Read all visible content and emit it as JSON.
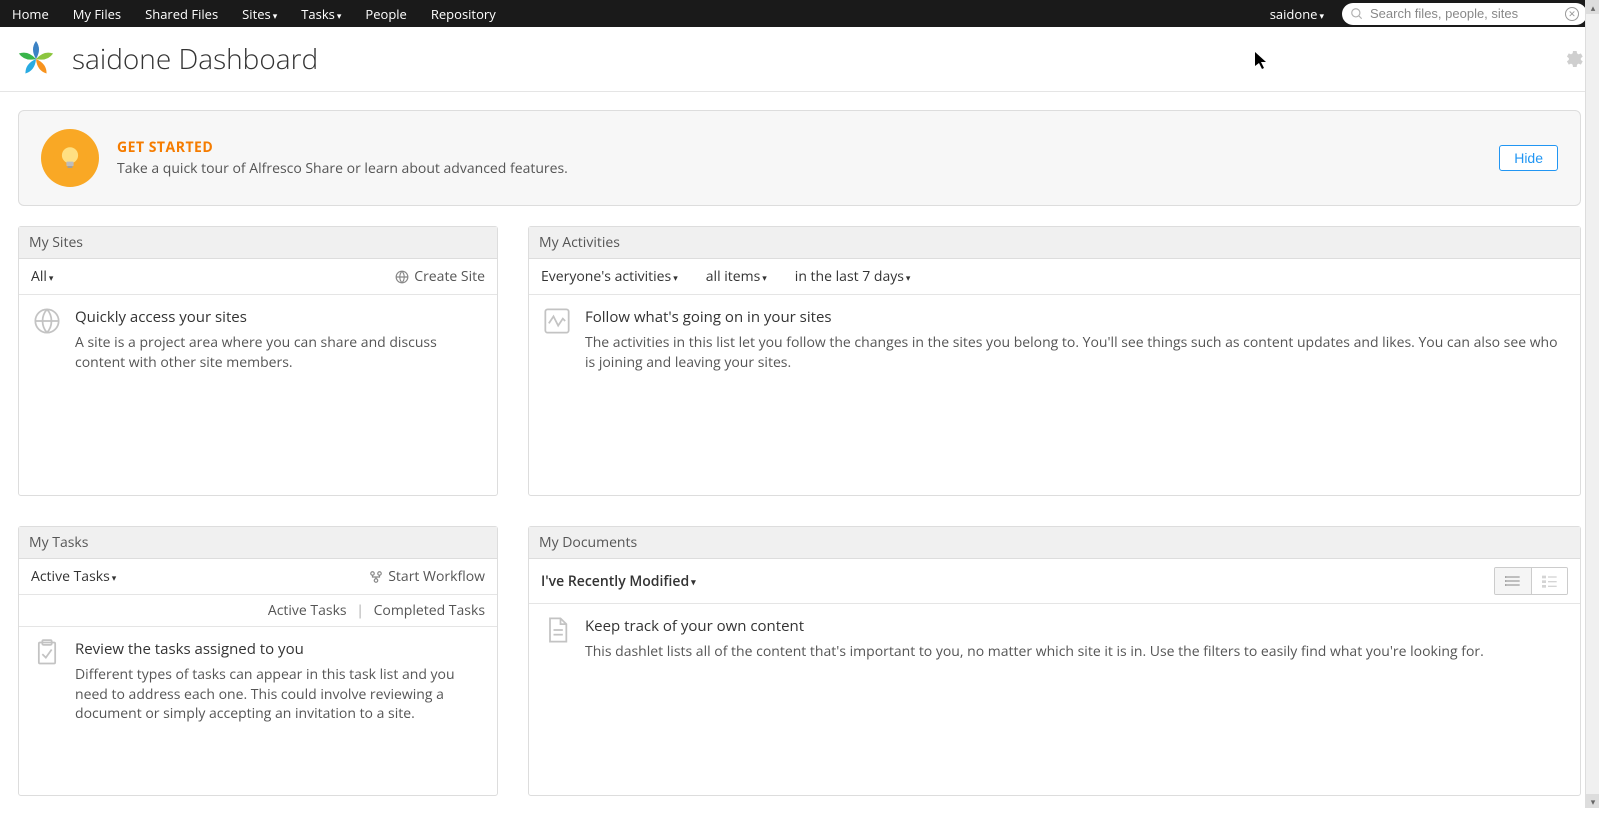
{
  "nav": {
    "items": [
      "Home",
      "My Files",
      "Shared Files",
      "Sites",
      "Tasks",
      "People",
      "Repository"
    ],
    "dropdowns": [
      false,
      false,
      false,
      true,
      true,
      false,
      false
    ],
    "user": "saidone",
    "search_placeholder": "Search files, people, sites"
  },
  "header": {
    "title": "saidone Dashboard"
  },
  "get_started": {
    "title": "GET STARTED",
    "desc": "Take a quick tour of Alfresco Share or learn about advanced features.",
    "hide": "Hide"
  },
  "my_sites": {
    "title": "My Sites",
    "filter": "All",
    "create": "Create Site",
    "info_title": "Quickly access your sites",
    "info_desc": "A site is a project area where you can share and discuss content with other site members."
  },
  "my_activities": {
    "title": "My Activities",
    "filters": [
      "Everyone's activities",
      "all items",
      "in the last 7 days"
    ],
    "info_title": "Follow what's going on in your sites",
    "info_desc": "The activities in this list let you follow the changes in the sites you belong to. You'll see things such as content updates and likes. You can also see who is joining and leaving your sites."
  },
  "my_tasks": {
    "title": "My Tasks",
    "filter": "Active Tasks",
    "start_workflow": "Start Workflow",
    "tabs": {
      "active": "Active Tasks",
      "completed": "Completed Tasks"
    },
    "info_title": "Review the tasks assigned to you",
    "info_desc": "Different types of tasks can appear in this task list and you need to address each one. This could involve reviewing a document or simply accepting an invitation to a site."
  },
  "my_documents": {
    "title": "My Documents",
    "filter": "I've Recently Modified",
    "info_title": "Keep track of your own content",
    "info_desc": "This dashlet lists all of the content that's important to you, no matter which site it is in. Use the filters to easily find what you're looking for."
  }
}
